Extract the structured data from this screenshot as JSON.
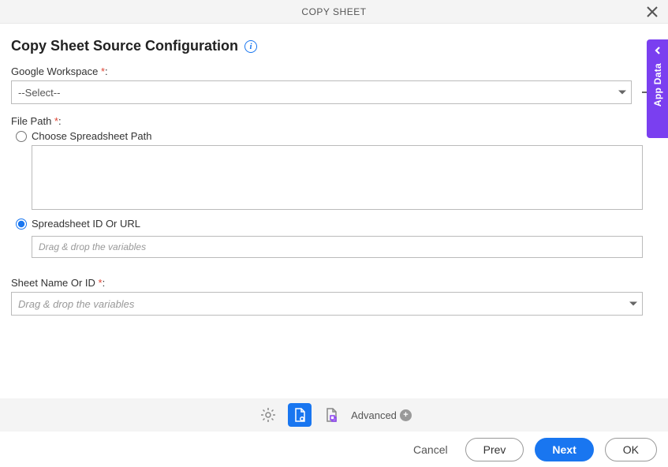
{
  "header": {
    "title": "COPY SHEET"
  },
  "page": {
    "title": "Copy Sheet Source Configuration"
  },
  "fields": {
    "workspace": {
      "label": "Google Workspace ",
      "req": "*",
      "colon": ":",
      "placeholder": "--Select--"
    },
    "filepath": {
      "label": "File Path ",
      "req": "*",
      "colon": ":",
      "option1": "Choose Spreadsheet Path",
      "option2": "Spreadsheet ID Or URL",
      "input_placeholder": "Drag & drop the variables"
    },
    "sheetname": {
      "label": "Sheet Name Or ID ",
      "req": "*",
      "colon": ":",
      "placeholder": "Drag & drop the variables"
    }
  },
  "sidepanel": {
    "label": "App Data"
  },
  "toolbar": {
    "advanced": "Advanced"
  },
  "footer": {
    "cancel": "Cancel",
    "prev": "Prev",
    "next": "Next",
    "ok": "OK"
  }
}
